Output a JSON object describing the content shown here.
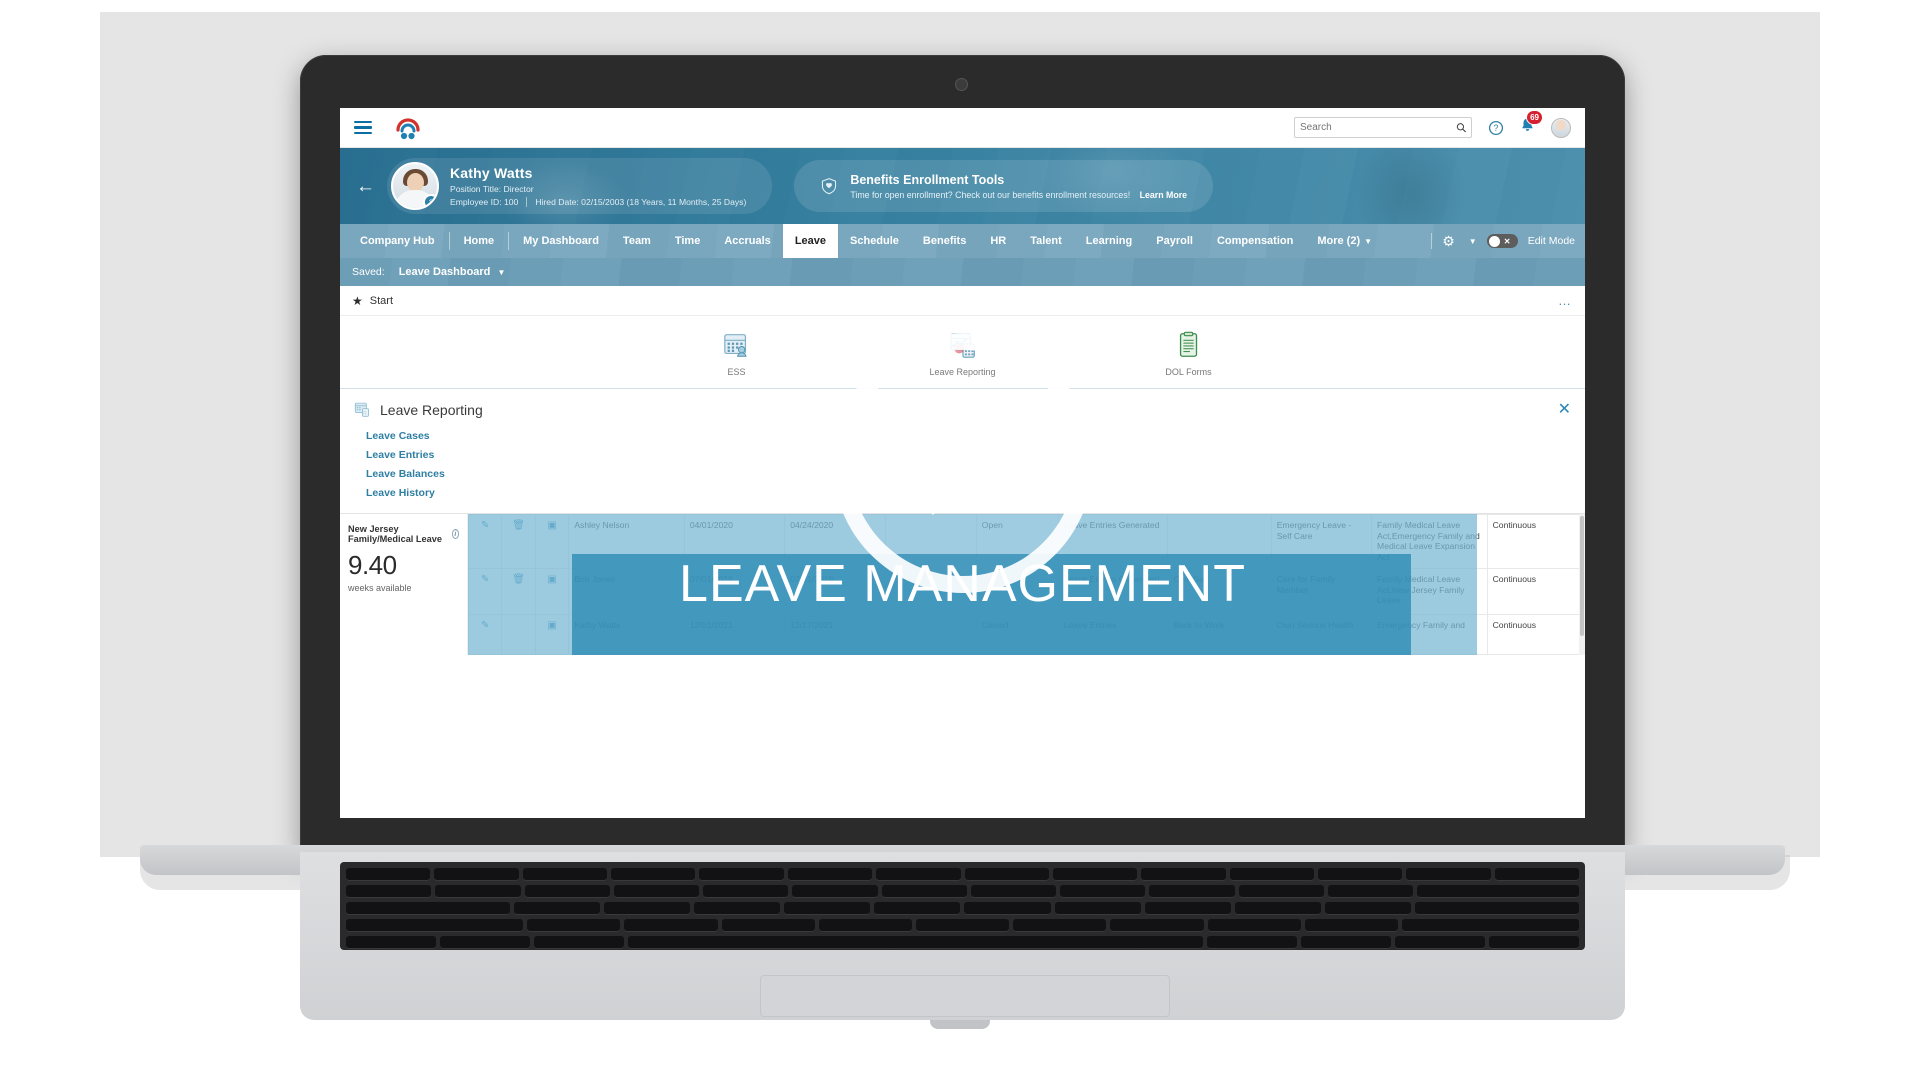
{
  "topbar": {
    "menu_icon": "hamburger-icon",
    "logo_icon": "app-logo-icon",
    "search_placeholder": "Search",
    "search_value": "",
    "search_icon": "search-icon",
    "help_icon": "help-icon",
    "notifications_icon": "bell-icon",
    "notifications_count": "69",
    "user_avatar_icon": "avatar-icon"
  },
  "hero": {
    "back_icon": "back-arrow-icon",
    "employee_name": "Kathy Watts",
    "position_line": "Position Title: Director",
    "employee_id": "Employee ID: 100",
    "hired_date": "Hired Date: 02/15/2003 (18 Years, 11 Months, 25 Days)",
    "promo_icon": "benefits-shield-icon",
    "promo_title": "Benefits Enrollment Tools",
    "promo_sub": "Time for open enrollment? Check out our benefits enrollment resources!",
    "promo_link": "Learn More"
  },
  "nav": {
    "items": [
      {
        "label": "Company Hub",
        "active": false
      },
      {
        "label": "Home",
        "active": false
      },
      {
        "label": "My Dashboard",
        "active": false
      },
      {
        "label": "Team",
        "active": false
      },
      {
        "label": "Time",
        "active": false
      },
      {
        "label": "Accruals",
        "active": false
      },
      {
        "label": "Leave",
        "active": true
      },
      {
        "label": "Schedule",
        "active": false
      },
      {
        "label": "Benefits",
        "active": false
      },
      {
        "label": "HR",
        "active": false
      },
      {
        "label": "Talent",
        "active": false
      },
      {
        "label": "Learning",
        "active": false
      },
      {
        "label": "Payroll",
        "active": false
      },
      {
        "label": "Compensation",
        "active": false
      }
    ],
    "more_label": "More (2)",
    "gear_icon": "gear-icon",
    "edit_mode_label": "Edit Mode",
    "edit_mode_state": "off"
  },
  "savedbar": {
    "saved_label": "Saved:",
    "selected_view": "Leave Dashboard"
  },
  "start_row": {
    "star_icon": "star-icon",
    "label": "Start",
    "overflow_icon": "ellipsis-icon"
  },
  "tiles": [
    {
      "label": "ESS",
      "icon": "calendar-person-icon"
    },
    {
      "label": "Leave Reporting",
      "icon": "report-calculator-icon"
    },
    {
      "label": "DOL Forms",
      "icon": "clipboard-forms-icon"
    }
  ],
  "panel": {
    "icon": "leave-reporting-icon",
    "title": "Leave Reporting",
    "close_icon": "close-icon",
    "links": [
      "Leave Cases",
      "Leave Entries",
      "Leave Balances",
      "Leave History"
    ]
  },
  "stat": {
    "title": "New Jersey Family/Medical Leave",
    "info_icon": "info-icon",
    "value": "9.40",
    "unit": "weeks available"
  },
  "table": {
    "row_icons": [
      "edit-icon",
      "delete-icon",
      "employee-case-icon"
    ],
    "rows": [
      {
        "employee": "Ashley Nelson",
        "start_date": "04/01/2020",
        "end_date": "04/24/2020",
        "blank": "",
        "status": "Open",
        "entries": "Leave Entries Generated",
        "return": "",
        "reason": "Emergency Leave - Self Care",
        "acts": "Family Medical Leave Act,Emergency Family and Medical Leave Expansion Act",
        "type": "Continuous"
      },
      {
        "employee": "Bob Jones",
        "start_date": "07/01/2019",
        "end_date": "07/31/2019",
        "blank": "",
        "status": "Open",
        "entries": "Leave Entries Generated",
        "return": "Own Ser",
        "reason": "Care for Family Member",
        "acts": "Family Medical Leave Act,New Jersey Family Leave",
        "type": "Continuous"
      },
      {
        "employee": "Kathy Watts",
        "start_date": "12/01/2021",
        "end_date": "12/17/2021",
        "blank": "",
        "status": "Closed",
        "entries": "Leave Entries",
        "return": "Back to Work",
        "reason": "Own Serious Health",
        "acts": "Emergency Family and",
        "type": "Continuous"
      }
    ]
  },
  "video": {
    "title_card": "LEAVE MANAGEMENT",
    "play_icon": "play-button-icon"
  },
  "colors": {
    "accent": "#2e7fa3",
    "hero": "#4a8aa8",
    "badge": "#d5202f",
    "title_card_band": "#2d8bb4"
  }
}
